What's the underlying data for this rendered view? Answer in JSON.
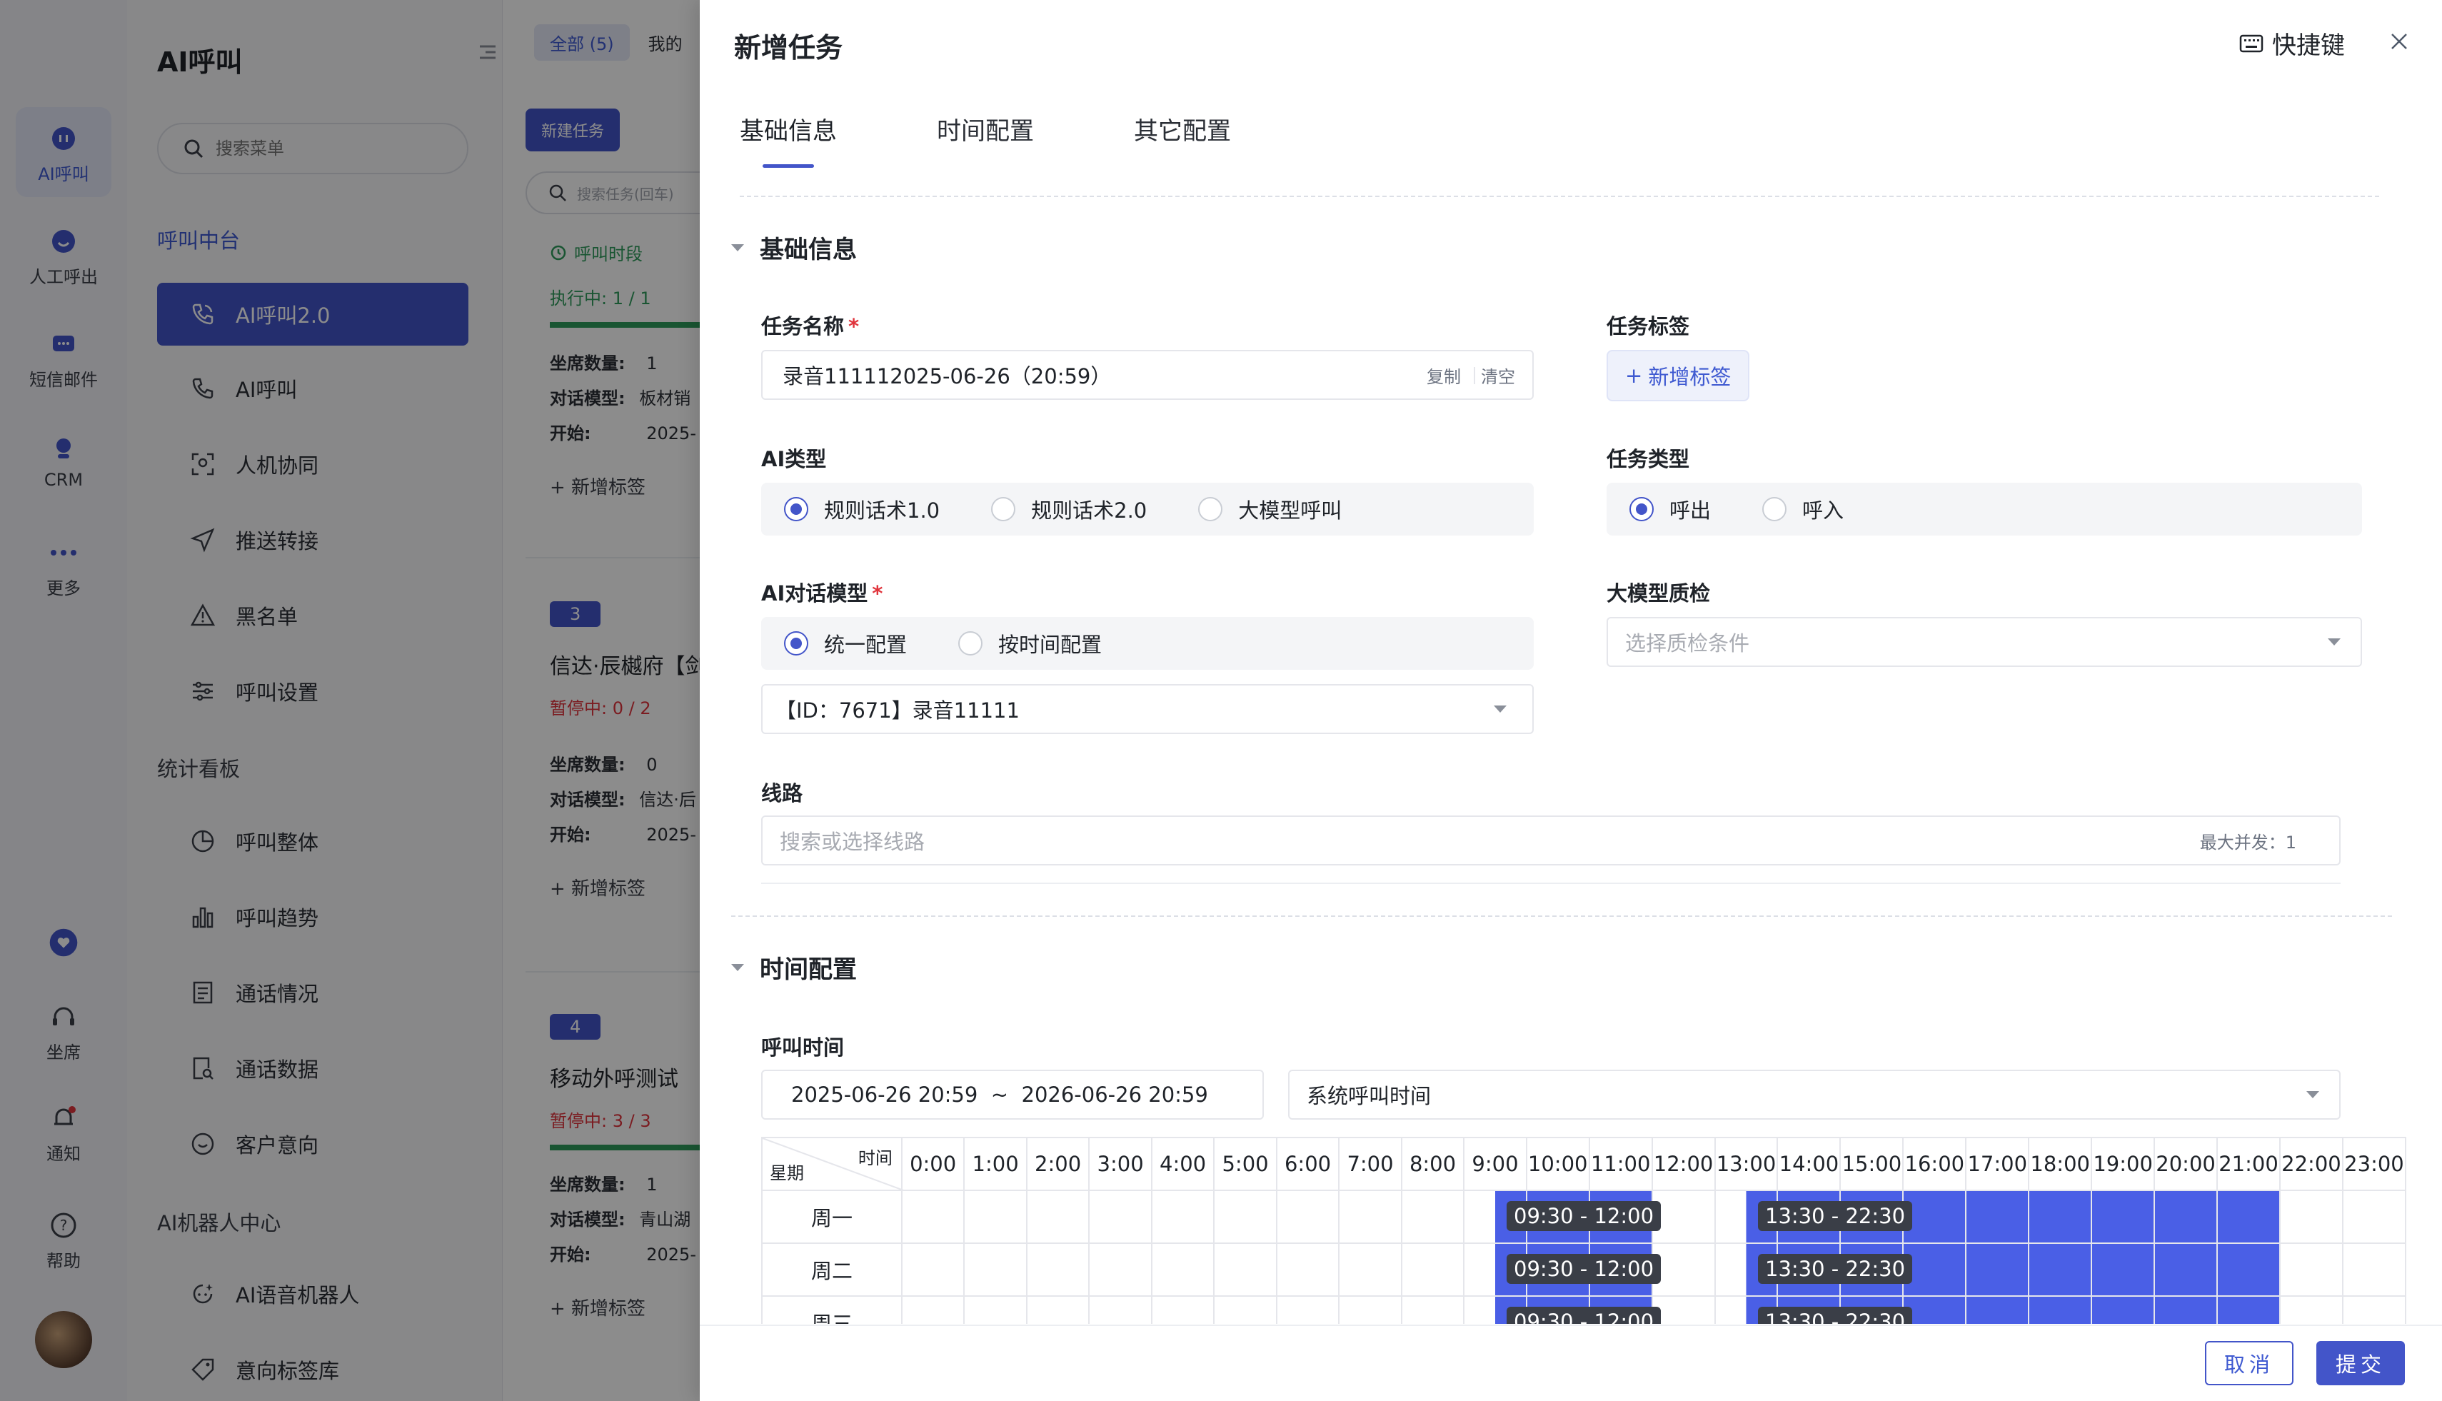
{
  "rail": {
    "items": [
      {
        "label": "AI呼叫",
        "icon": "ai-call-icon"
      },
      {
        "label": "人工呼出",
        "icon": "manual-call-icon"
      },
      {
        "label": "短信邮件",
        "icon": "sms-icon"
      },
      {
        "label": "CRM",
        "icon": "crm-icon"
      },
      {
        "label": "更多",
        "icon": "more-icon"
      },
      {
        "label": "坐席",
        "icon": "headset-icon"
      },
      {
        "label": "通知",
        "icon": "bell-icon"
      },
      {
        "label": "帮助",
        "icon": "help-icon"
      }
    ]
  },
  "menu": {
    "title": "AI呼叫",
    "search_placeholder": "搜索菜单",
    "sections": {
      "call_center": "呼叫中台",
      "stats": "统计看板",
      "robot": "AI机器人中心"
    },
    "items": {
      "ai_call_2": "AI呼叫2.0",
      "ai_call": "AI呼叫",
      "collab": "人机协同",
      "push": "推送转接",
      "blacklist": "黑名单",
      "settings": "呼叫设置",
      "overall": "呼叫整体",
      "trend": "呼叫趋势",
      "calls": "通话情况",
      "data": "通话数据",
      "intent": "客户意向",
      "voice_robot": "AI语音机器人",
      "intent_tags": "意向标签库"
    }
  },
  "tasklist": {
    "tab_all": "全部 (5)",
    "tab_mine": "我的",
    "new_button": "新建任务",
    "search_placeholder": "搜索任务(回车)",
    "period_label": "呼叫时段",
    "cards": [
      {
        "num": "",
        "name": "",
        "status": "执行中: 1 / 1",
        "seats": "坐席数量:",
        "seats_val": "1",
        "model": "对话模型:",
        "model_val": "板材销",
        "start": "开始:",
        "start_val": "2025-",
        "add_tag": "+ 新增标签"
      },
      {
        "num": "3",
        "name": "信达·辰樾府【剑",
        "status": "暂停中: 0 / 2",
        "seats": "坐席数量:",
        "seats_val": "0",
        "model": "对话模型:",
        "model_val": "信达·后",
        "start": "开始:",
        "start_val": "2025-",
        "add_tag": "+ 新增标签"
      },
      {
        "num": "4",
        "name": "移动外呼测试",
        "status": "暂停中: 3 / 3",
        "seats": "坐席数量:",
        "seats_val": "1",
        "model": "对话模型:",
        "model_val": "青山湖",
        "start": "开始:",
        "start_val": "2025-",
        "add_tag": "+ 新增标签"
      }
    ]
  },
  "drawer": {
    "title": "新增任务",
    "shortcut": "快捷键",
    "tabs": [
      "基础信息",
      "时间配置",
      "其它配置"
    ],
    "basic": {
      "section_title": "基础信息",
      "task_name_label": "任务名称",
      "task_name_value": "录音111112025-06-26（20:59）",
      "copy": "复制",
      "clear": "清空",
      "task_tag_label": "任务标签",
      "add_tag": "新增标签",
      "ai_type_label": "AI类型",
      "ai_types": [
        "规则话术1.0",
        "规则话术2.0",
        "大模型呼叫"
      ],
      "ai_type_selected": 0,
      "task_type_label": "任务类型",
      "task_types": [
        "呼出",
        "呼入"
      ],
      "task_type_selected": 0,
      "ai_model_label": "AI对话模型",
      "ai_model_modes": [
        "统一配置",
        "按时间配置"
      ],
      "ai_model_mode_selected": 0,
      "ai_model_value": "【ID：7671】录音11111",
      "qc_label": "大模型质检",
      "qc_placeholder": "选择质检条件",
      "line_label": "线路",
      "line_placeholder": "搜索或选择线路",
      "max_concurrency": "最大并发：1"
    },
    "time": {
      "section_title": "时间配置",
      "call_time_label": "呼叫时间",
      "date_range": "2025-06-26 20:59  ~  2026-06-26 20:59",
      "time_source": "系统呼叫时间",
      "corner_time": "时间",
      "corner_day": "星期",
      "hours": [
        "0:00",
        "1:00",
        "2:00",
        "3:00",
        "4:00",
        "5:00",
        "6:00",
        "7:00",
        "8:00",
        "9:00",
        "10:00",
        "11:00",
        "12:00",
        "13:00",
        "14:00",
        "15:00",
        "16:00",
        "17:00",
        "18:00",
        "19:00",
        "20:00",
        "21:00",
        "22:00",
        "23:00"
      ],
      "days": [
        "周一",
        "周二",
        "周三"
      ],
      "ranges": [
        "09:30 - 12:00",
        "13:30 - 22:30"
      ],
      "range_values": [
        [
          9.5,
          12.0
        ],
        [
          13.5,
          22.5
        ]
      ]
    },
    "footer": {
      "cancel": "取消",
      "submit": "提交"
    }
  },
  "colors": {
    "primary": "#4355c9",
    "grid_fill": "#4a5fe6",
    "success": "#2e9b5b",
    "danger": "#e0343c"
  }
}
